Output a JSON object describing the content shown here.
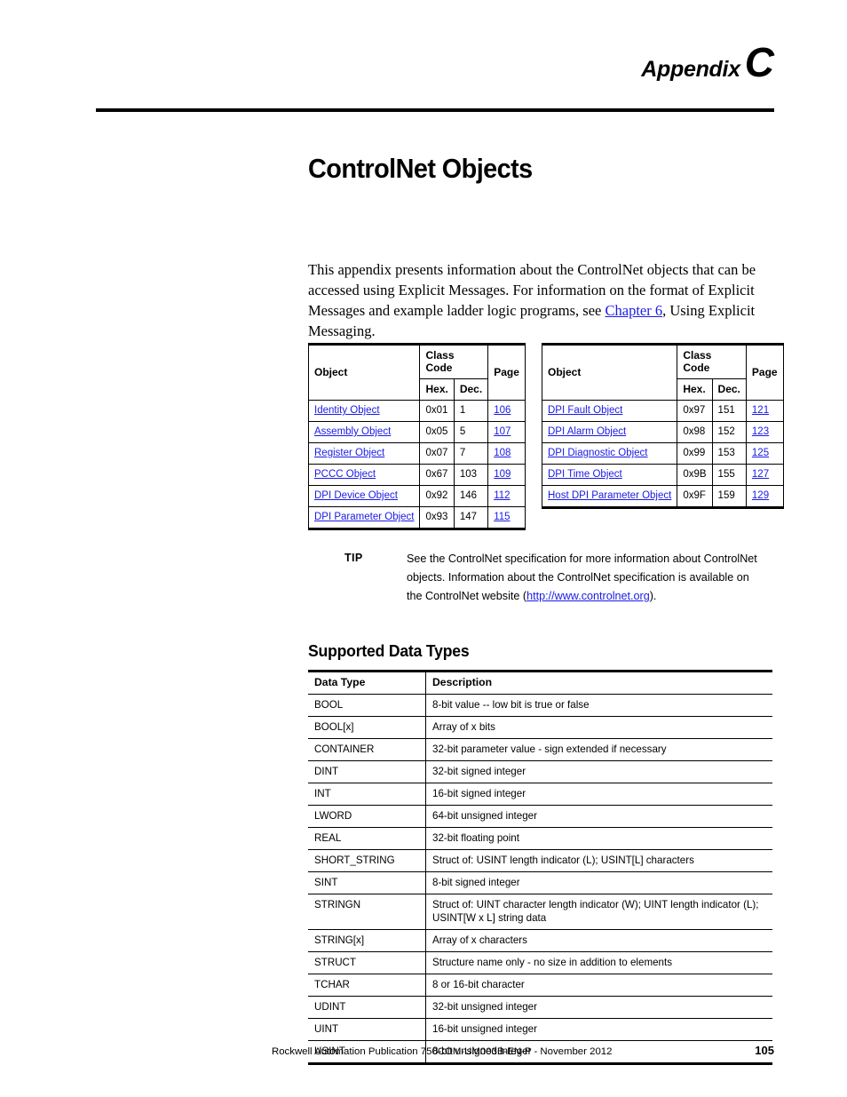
{
  "header": {
    "appendix_word": "Appendix",
    "appendix_letter": "C"
  },
  "title": "ControlNet Objects",
  "intro": {
    "part1": "This appendix presents information about the ControlNet objects that can be accessed using Explicit Messages. For information on the format of Explicit Messages and example ladder logic programs, see ",
    "link": "Chapter 6",
    "part2": ", Using Explicit Messaging."
  },
  "object_tables": {
    "headers": {
      "object": "Object",
      "class_code": "Class Code",
      "page": "Page",
      "hex": "Hex.",
      "dec": "Dec."
    },
    "left_rows": [
      {
        "object": "Identity Object",
        "hex": "0x01",
        "dec": "1",
        "page": "106"
      },
      {
        "object": "Assembly Object",
        "hex": "0x05",
        "dec": "5",
        "page": "107"
      },
      {
        "object": "Register Object",
        "hex": "0x07",
        "dec": "7",
        "page": "108"
      },
      {
        "object": "PCCC Object",
        "hex": "0x67",
        "dec": "103",
        "page": "109"
      },
      {
        "object": "DPI Device Object",
        "hex": "0x92",
        "dec": "146",
        "page": "112"
      },
      {
        "object": "DPI Parameter Object",
        "hex": "0x93",
        "dec": "147",
        "page": "115"
      }
    ],
    "right_rows": [
      {
        "object": "DPI Fault Object",
        "hex": "0x97",
        "dec": "151",
        "page": "121"
      },
      {
        "object": "DPI Alarm Object",
        "hex": "0x98",
        "dec": "152",
        "page": "123"
      },
      {
        "object": "DPI Diagnostic Object",
        "hex": "0x99",
        "dec": "153",
        "page": "125"
      },
      {
        "object": "DPI Time Object",
        "hex": "0x9B",
        "dec": "155",
        "page": "127"
      },
      {
        "object": "Host DPI Parameter Object",
        "hex": "0x9F",
        "dec": "159",
        "page": "129"
      }
    ]
  },
  "tip": {
    "label": "TIP",
    "text_part1": "See the ControlNet specification for more information about ControlNet objects. Information about the ControlNet specification is available on the ControlNet website (",
    "link": "http://www.controlnet.org",
    "text_part2": ")."
  },
  "data_types_section": {
    "heading": "Supported Data Types",
    "headers": {
      "data_type": "Data Type",
      "description": "Description"
    },
    "rows": [
      {
        "type": "BOOL",
        "desc": "8-bit value -- low bit is true or false"
      },
      {
        "type": "BOOL[x]",
        "desc": "Array of x bits"
      },
      {
        "type": "CONTAINER",
        "desc": "32-bit parameter value - sign extended if necessary"
      },
      {
        "type": "DINT",
        "desc": "32-bit signed integer"
      },
      {
        "type": "INT",
        "desc": "16-bit signed integer"
      },
      {
        "type": "LWORD",
        "desc": "64-bit unsigned integer"
      },
      {
        "type": "REAL",
        "desc": "32-bit floating point"
      },
      {
        "type": "SHORT_STRING",
        "desc": "Struct of: USINT length indicator (L); USINT[L] characters"
      },
      {
        "type": "SINT",
        "desc": "8-bit signed integer"
      },
      {
        "type": "STRINGN",
        "desc": "Struct of: UINT character length indicator (W); UINT length indicator (L); USINT[W x L] string data"
      },
      {
        "type": "STRING[x]",
        "desc": "Array of x characters"
      },
      {
        "type": "STRUCT",
        "desc": "Structure name only - no size in addition to elements"
      },
      {
        "type": "TCHAR",
        "desc": "8 or 16-bit character"
      },
      {
        "type": "UDINT",
        "desc": "32-bit unsigned integer"
      },
      {
        "type": "UINT",
        "desc": "16-bit unsigned integer"
      },
      {
        "type": "USINT",
        "desc": "8-bit unsigned integer"
      }
    ]
  },
  "footer": {
    "publication": "Rockwell Automation Publication 750COM-UM003B-EN-P - November 2012",
    "page_number": "105"
  },
  "colors": {
    "link": "#1a1ae6",
    "text": "#000000",
    "background": "#ffffff"
  }
}
